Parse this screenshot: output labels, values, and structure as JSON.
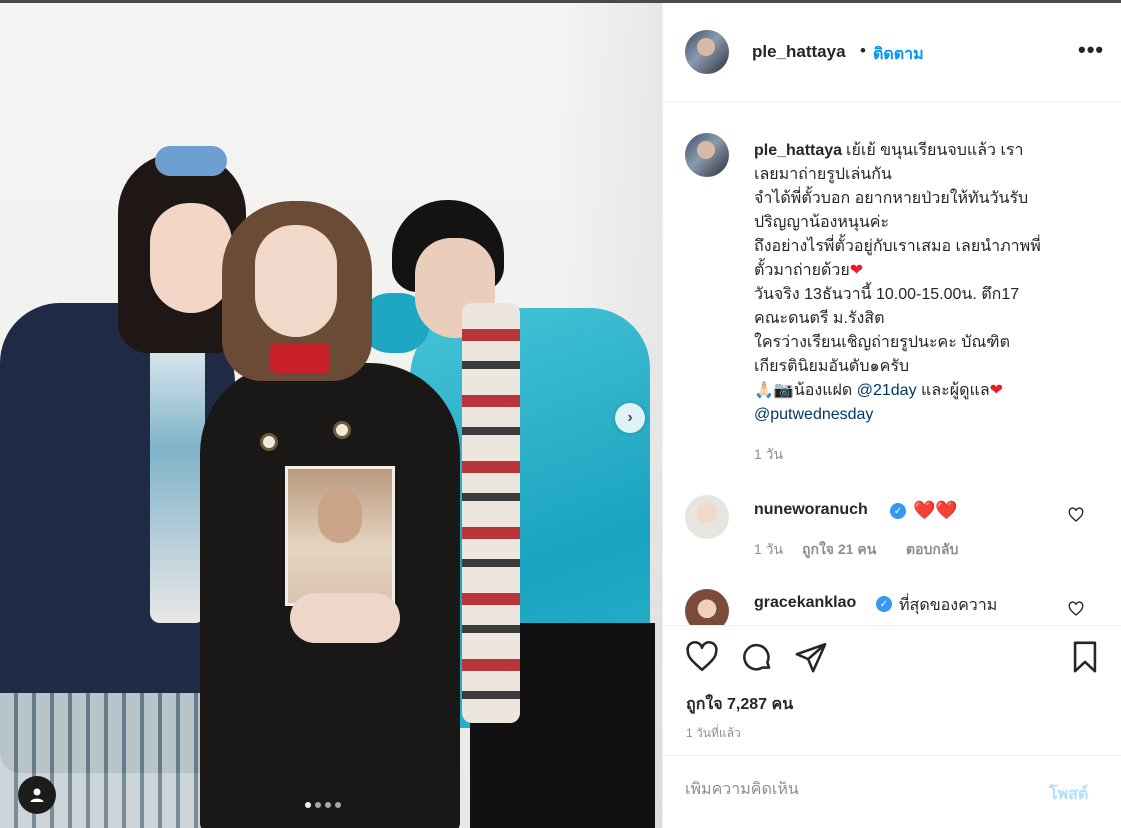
{
  "post": {
    "username": "ple_hattaya",
    "follow_label": "ติดตาม",
    "separator": "•",
    "more_label": "•••",
    "carousel": {
      "slide_count": 4,
      "active_slide": 1,
      "next_label": "›"
    }
  },
  "caption": {
    "username": "ple_hattaya",
    "lines": [
      "เย้เย้ ขนุนเรียนจบแล้ว เรา",
      "เลยมาถ่ายรูปเล่นกัน",
      "จำได้พี่ตั้วบอก อยากหายป่วยให้ทันวันรับ",
      "ปริญญาน้องหนุนค่ะ",
      "ถึงอย่างไรพี่ตั้วอยู่กับเราเสมอ เลยนำภาพพี่",
      "ตั้วมาถ่ายด้วย",
      "วันจริง 13ธันวานี้ 10.00-15.00น. ตึก17",
      "คณะดนตรี ม.รังสิต",
      "ใครว่างเรียนเชิญถ่ายรูปนะคะ บัณฑิต",
      "เกียรตินิยมอันดับ๑ครับ"
    ],
    "heart": "❤",
    "last_line_prefix": "🙏🏻📷น้องแฝด",
    "mention1": "@21day",
    "last_line_middle": "และผู้ดูแล",
    "mention2": "@putwednesday",
    "time": "1 วัน"
  },
  "comments": [
    {
      "username": "nuneworanuch",
      "verified": true,
      "text": "❤️❤️",
      "time": "1 วัน",
      "likes": "ถูกใจ 21 คน",
      "reply": "ตอบกลับ"
    },
    {
      "username": "gracekanklao",
      "verified": true,
      "text": "ที่สุดของความ"
    }
  ],
  "actions": {
    "likes": "ถูกใจ 7,287 คน",
    "posted": "1 วันที่แล้ว"
  },
  "comment_box": {
    "placeholder": "เพิ่มความคิดเห็น",
    "post_label": "โพสต์"
  },
  "colors": {
    "accent": "#0095f6",
    "mention": "#00376b",
    "heart": "#ed1c24",
    "muted": "#8e8e8e",
    "disabled_post": "#b2dffc"
  },
  "icons": [
    "heart-icon",
    "comment-icon",
    "share-icon",
    "bookmark-icon",
    "user-tag-icon",
    "verified-icon",
    "more-icon"
  ]
}
